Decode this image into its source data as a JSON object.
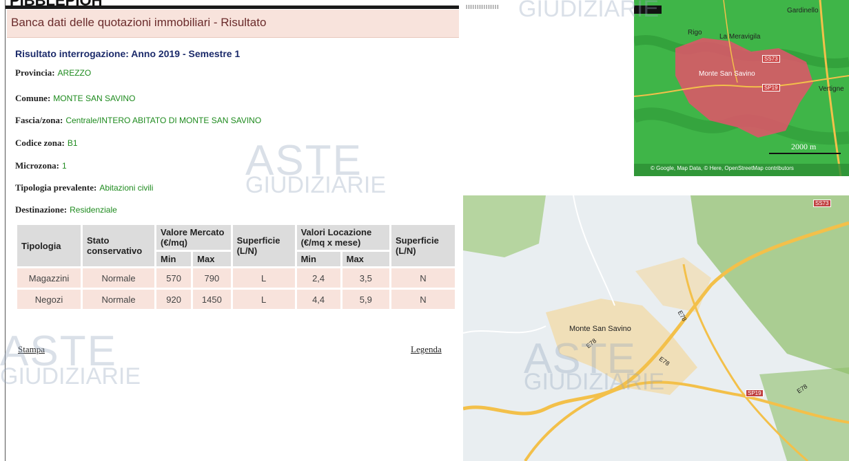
{
  "header": {
    "title_fragment": "PIBBLEPIOH",
    "top_note": "IIIIIIIIIIIIIII"
  },
  "panel": {
    "title": "Banca dati delle quotazioni immobiliari - Risultato"
  },
  "result": {
    "heading": "Risultato interrogazione: Anno 2019 - Semestre 1",
    "fields": [
      {
        "label": "Provincia:",
        "value": "AREZZO"
      },
      {
        "label": "Comune:",
        "value": "MONTE SAN SAVINO"
      },
      {
        "label": "Fascia/zona:",
        "value": "Centrale/INTERO ABITATO DI MONTE SAN SAVINO"
      },
      {
        "label": "Codice zona:",
        "value": "B1"
      },
      {
        "label": "Microzona:",
        "value": "1"
      },
      {
        "label": "Tipologia prevalente:",
        "value": "Abitazioni civili"
      },
      {
        "label": "Destinazione:",
        "value": "Residenziale"
      }
    ]
  },
  "table": {
    "headers": {
      "tipologia": "Tipologia",
      "stato": "Stato conservativo",
      "valore": "Valore Mercato (€/mq)",
      "superficie1": "Superficie (L/N)",
      "locazione": "Valori Locazione (€/mq x mese)",
      "superficie2": "Superficie (L/N)",
      "min": "Min",
      "max": "Max"
    },
    "rows": [
      [
        "Magazzini",
        "Normale",
        "570",
        "790",
        "L",
        "2,4",
        "3,5",
        "N"
      ],
      [
        "Negozi",
        "Normale",
        "920",
        "1450",
        "L",
        "4,4",
        "5,9",
        "N"
      ]
    ]
  },
  "links": {
    "stampa": "Stampa",
    "legenda": "Legenda"
  },
  "watermark": {
    "aste": "ASTE",
    "giudiziarie": "GIUDIZIARIE"
  },
  "map1": {
    "labels": [
      "Gardinello",
      "Rigo",
      "La Meravigila",
      "Monte San Savino",
      "Vertigne"
    ],
    "badges": [
      "SS73",
      "SP19"
    ],
    "scale": "2000 m",
    "attribution": "© Google, Map Data, © Here, OpenStreetMap contributors"
  },
  "map2": {
    "labels": [
      "Monte San Savino"
    ],
    "badges": [
      "SS73",
      "SP19"
    ],
    "roads": [
      "E78",
      "E78",
      "E78",
      "E78"
    ]
  },
  "colors": {
    "title_bg": "#f8e3dc",
    "value_green": "#1d8a1d",
    "heading_blue": "#1b2a6a",
    "header_gray": "#dcdcdc"
  }
}
